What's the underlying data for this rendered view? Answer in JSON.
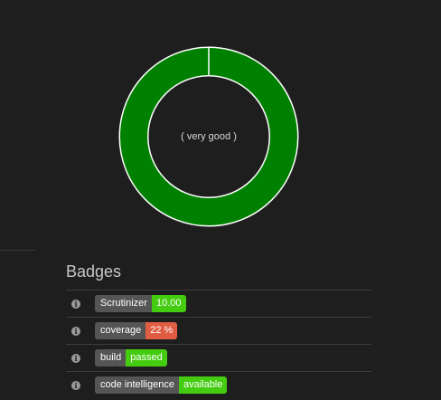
{
  "donut": {
    "center_text": "( very good )",
    "fill_fraction": 1.0,
    "fill_color": "#008000",
    "stroke_color": "#ffffff"
  },
  "badges": {
    "title": "Badges",
    "items": [
      {
        "label": "Scrutinizer",
        "value": "10.00",
        "color": "#4c1"
      },
      {
        "label": "coverage",
        "value": "22 %",
        "color": "#e05d44"
      },
      {
        "label": "build",
        "value": "passed",
        "color": "#4c1"
      },
      {
        "label": "code intelligence",
        "value": "available",
        "color": "#4c1"
      }
    ],
    "info_icon": "info-icon"
  }
}
